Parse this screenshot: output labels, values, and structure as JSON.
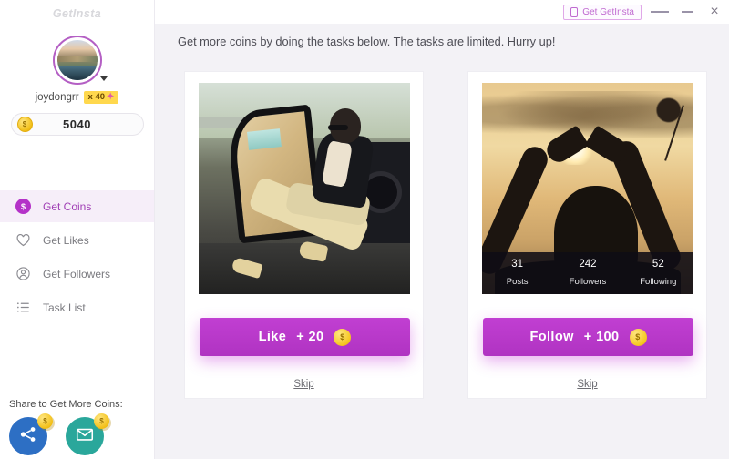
{
  "app": {
    "brand": "GetInsta"
  },
  "titlebar": {
    "get_app_label": "Get GetInsta",
    "phone_icon": "phone-icon",
    "menu_icon": "hamburger-menu-icon",
    "minimize_icon": "minimize-icon",
    "close_icon": "close-icon",
    "close_glyph": "×"
  },
  "sidebar": {
    "avatar_name": "avatar",
    "username": "joydongrr",
    "multiplier_badge": "x 40",
    "bolt_glyph": "⚡",
    "coin_symbol": "$",
    "coin_balance": "5040",
    "nav": [
      {
        "label": "Get Coins",
        "icon": "coin-icon",
        "active": true
      },
      {
        "label": "Get Likes",
        "icon": "heart-icon",
        "active": false
      },
      {
        "label": "Get Followers",
        "icon": "user-circle-icon",
        "active": false
      },
      {
        "label": "Task List",
        "icon": "list-icon",
        "active": false
      }
    ],
    "share_label": "Share to Get More Coins:",
    "share_buttons": [
      {
        "name": "share-social-button",
        "icon": "share-nodes-icon",
        "color": "#2d6fc4",
        "coin": "$"
      },
      {
        "name": "share-email-button",
        "icon": "envelope-icon",
        "color": "#2aa79b",
        "coin": "$"
      }
    ]
  },
  "main": {
    "headline": "Get more coins by doing the tasks below. The tasks are limited. Hurry up!",
    "cards": [
      {
        "photo_name": "task-photo-man-in-car",
        "photo_alt": "Man in sunglasses sitting in open car door",
        "has_stats": false,
        "action_label": "Like",
        "action_amount": "+ 20",
        "coin_symbol": "$",
        "skip_label": "Skip"
      },
      {
        "photo_name": "task-photo-sunset-heart-hands",
        "photo_alt": "Silhouette of hands forming a heart against a sunset",
        "has_stats": true,
        "stats": [
          {
            "value": "31",
            "label": "Posts"
          },
          {
            "value": "242",
            "label": "Followers"
          },
          {
            "value": "52",
            "label": "Following"
          }
        ],
        "action_label": "Follow",
        "action_amount": "+ 100",
        "coin_symbol": "$",
        "skip_label": "Skip"
      }
    ]
  },
  "colors": {
    "accent_purple": "#b432c8",
    "accent_pink_btn": "#c13fd2",
    "coin_gold": "#f2bf17",
    "badge_yellow": "#ffd84d",
    "page_bg": "#f3f2f6",
    "active_nav_bg": "#f6eef9",
    "share_blue": "#2d6fc4",
    "share_teal": "#2aa79b"
  }
}
